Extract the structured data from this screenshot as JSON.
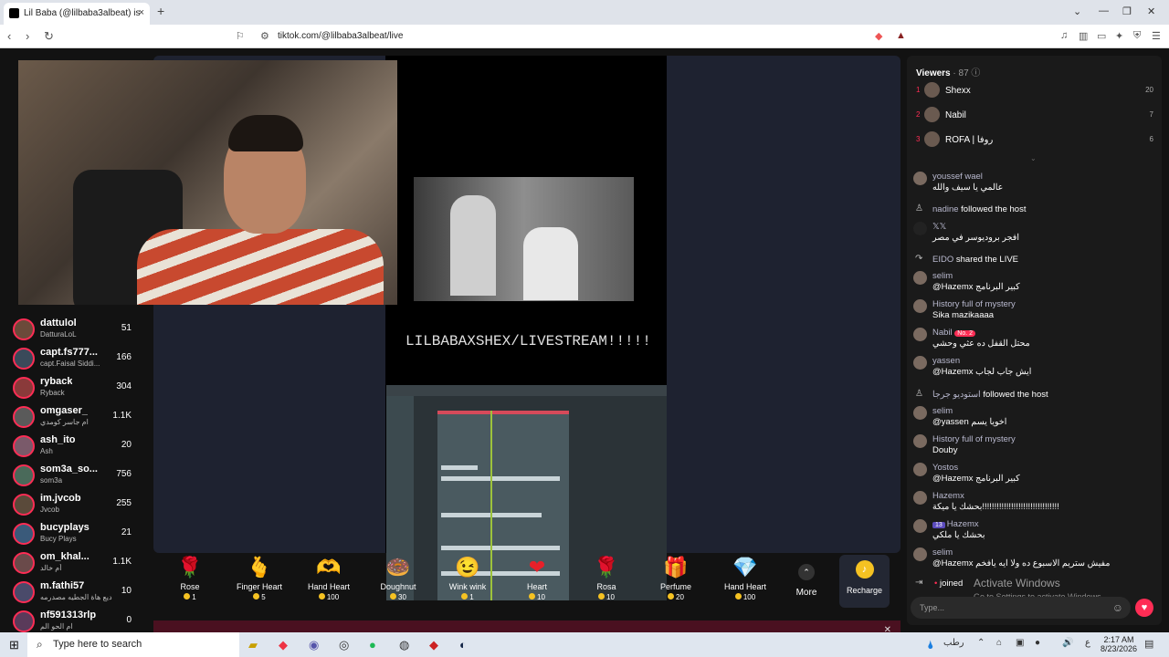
{
  "browser": {
    "tab_title": "Lil Baba (@lilbaba3albeat) is",
    "url": "tiktok.com/@lilbaba3albeat/live",
    "new_tab": "+",
    "close_tab": "×"
  },
  "stream": {
    "overlay_text": "LILBABAXSHEX/LIVESTREAM!!!!!"
  },
  "left_list": [
    {
      "name": "dattulol",
      "sub": "DatturaLoL",
      "count": "51"
    },
    {
      "name": "capt.fs777...",
      "sub": "capt.Faisal Siddi...",
      "count": "166"
    },
    {
      "name": "ryback",
      "sub": "Ryback",
      "count": "304"
    },
    {
      "name": "omgaser_",
      "sub": "ام جاسر كومدي",
      "count": "1.1K"
    },
    {
      "name": "ash_ito",
      "sub": "Ash",
      "count": "20"
    },
    {
      "name": "som3a_so...",
      "sub": "som3a",
      "count": "756"
    },
    {
      "name": "im.jvcob",
      "sub": "Jvcob",
      "count": "255"
    },
    {
      "name": "bucyplays",
      "sub": "Bucy Plays",
      "count": "21"
    },
    {
      "name": "om_khal...",
      "sub": "أم خالد",
      "count": "1.1K"
    },
    {
      "name": "m.fathi57",
      "sub": "ديع هاة الجطيه مصدرمه",
      "count": "10"
    },
    {
      "name": "nf591313rlp",
      "sub": "ام الحو الم",
      "count": "0"
    }
  ],
  "gifts": [
    {
      "name": "Rose",
      "price": "1",
      "icon": "🌹"
    },
    {
      "name": "Finger Heart",
      "price": "5",
      "icon": "🫰"
    },
    {
      "name": "Hand Heart",
      "price": "100",
      "icon": "🫶"
    },
    {
      "name": "Doughnut",
      "price": "30",
      "icon": "🍩"
    },
    {
      "name": "Wink wink",
      "price": "1",
      "icon": "😉"
    },
    {
      "name": "Heart",
      "price": "10",
      "icon": "❤"
    },
    {
      "name": "Rosa",
      "price": "10",
      "icon": "🌹"
    },
    {
      "name": "Perfume",
      "price": "20",
      "icon": "🎁"
    },
    {
      "name": "Hand Heart",
      "price": "100",
      "icon": "💎"
    }
  ],
  "gift_more": "More",
  "recharge": "Recharge",
  "viewers": {
    "title": "Viewers",
    "count": "· 87",
    "top": [
      {
        "rank": "1",
        "name": "Shexx",
        "count": "20"
      },
      {
        "rank": "2",
        "name": "Nabil",
        "count": "7"
      },
      {
        "rank": "3",
        "name": "ROFA | روفا",
        "count": "6"
      }
    ]
  },
  "chat": [
    {
      "user": "youssef wael",
      "msg": "عالمي يا سيف والله"
    },
    {
      "user": "nadine",
      "event": "followed the host"
    },
    {
      "user": "𝕏𝕏",
      "msg": "افجر بروديوسر في مصر"
    },
    {
      "user": "EIDO",
      "event": "shared the LIVE"
    },
    {
      "user": "selim",
      "msg": "@Hazemx كبير البرنامج"
    },
    {
      "user": "History full of mystery",
      "msg": "Sika mazikaaaa"
    },
    {
      "user": "Nabil",
      "badge": "No. 2",
      "msg": "محتل القفل ده عثي وحشي"
    },
    {
      "user": "yassen",
      "msg": "@Hazemx ايش جاب لجاب"
    },
    {
      "user": "استوديو جرجا",
      "event": "followed the host"
    },
    {
      "user": "selim",
      "msg": "@yassen اخويا يسم"
    },
    {
      "user": "History full of mystery",
      "msg": "Douby"
    },
    {
      "user": "Yostos",
      "msg": "@Hazemx كبير البرنامج"
    },
    {
      "user": "Hazemx",
      "msg": "بحشك يا ميكة!!!!!!!!!!!!!!!!!!!!!!!!!!!!!!!!"
    },
    {
      "user": "Hazemx",
      "level": "13",
      "msg": "بحشك يا ملكي"
    },
    {
      "user": "selim",
      "msg": "@Hazemx مفيش ستريم الاسبوع ده ولا ايه يافخم"
    },
    {
      "user": "",
      "event": "joined"
    }
  ],
  "input_placeholder": "Type...",
  "watermark": {
    "title": "Activate Windows",
    "sub": "Go to Settings to activate Windows."
  },
  "taskbar": {
    "search": "Type here to search",
    "time": "2:17 AM",
    "date": "8/23/2026",
    "weather": "رطب"
  }
}
